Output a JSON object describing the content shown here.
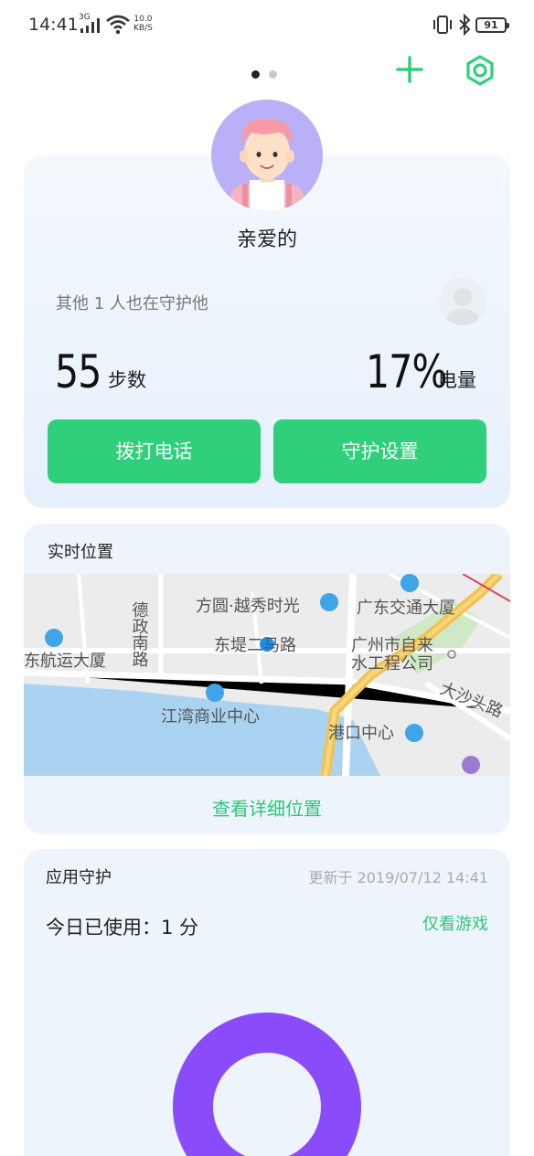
{
  "status_bar": {
    "time": "14:41",
    "network": "3G",
    "speed_value": "10.0",
    "speed_unit": "KB/S",
    "battery": "91"
  },
  "header": {
    "page_indicator": {
      "count": 2,
      "active": 0
    },
    "add_icon": "plus-icon",
    "settings_icon": "gear-icon",
    "accent_color": "#2fcf7c"
  },
  "profile": {
    "name": "亲爱的",
    "others_guarding": "其他 1 人也在守护他",
    "steps_value": "55",
    "steps_label": "步数",
    "battery_value": "17%",
    "battery_label": "电量",
    "call_button": "拨打电话",
    "guard_settings_button": "守护设置"
  },
  "location": {
    "title": "实时位置",
    "map_labels": [
      "德政南路",
      "方圆·越秀时光",
      "广东交通大厦",
      "东航运大厦",
      "东堤二马路",
      "广州市自来水工程公司",
      "大沙头路",
      "江湾商业中心",
      "港口中心"
    ],
    "detail_link": "查看详细位置"
  },
  "app_guard": {
    "title": "应用守护",
    "updated": "更新于 2019/07/12 14:41",
    "usage": "今日已使用：1 分",
    "filter": "仅看游戏",
    "donut_color": "#8a4bfa"
  }
}
